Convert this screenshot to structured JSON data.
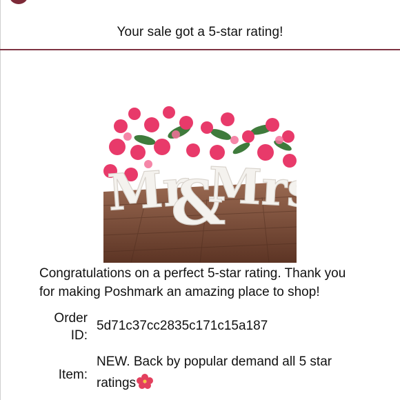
{
  "header": {
    "title": "Your sale got a 5-star rating!"
  },
  "product_image": {
    "image_text": "Mr&Mrs"
  },
  "message": {
    "congrats": "Congratulations on a perfect 5-star rating. Thank you for making Poshmark an amazing place to shop!"
  },
  "details": {
    "order_label": "Order ID:",
    "order_id": "5d71c37cc2835c171c15a187",
    "item_label": "Item:",
    "item_text": "NEW. Back by popular demand all 5 star ratings",
    "item_emoji_icon": "hibiscus-icon"
  },
  "colors": {
    "accent": "#7d3342",
    "floral_pink": "#e83a6a",
    "wood": "#7a4a36"
  }
}
